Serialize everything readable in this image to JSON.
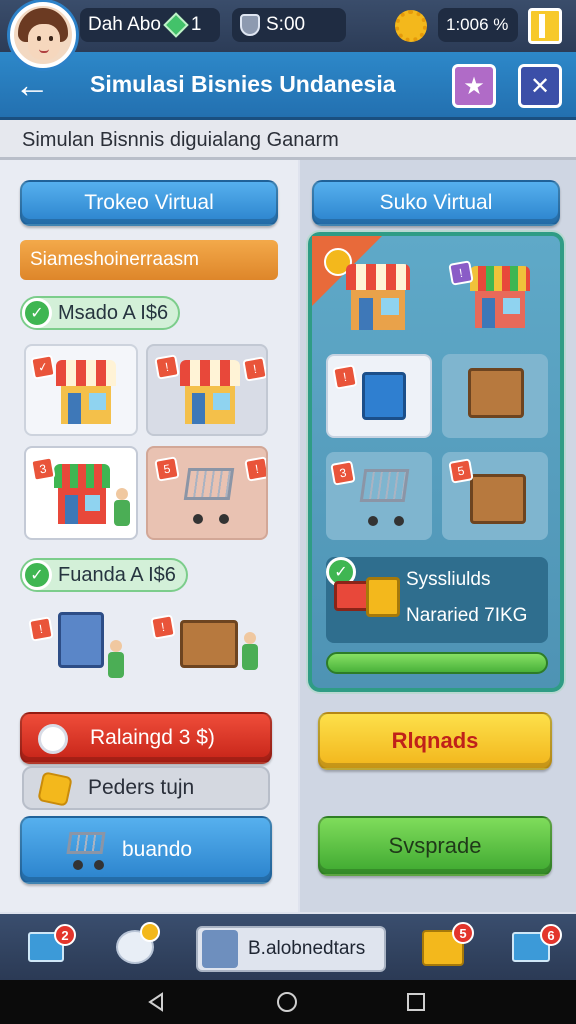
{
  "header": {
    "player_name": "Dah Abo",
    "gem_count": "1",
    "shield_value": "S:00",
    "percent_value": "1:006 %"
  },
  "titlebar": {
    "title": "Simulasi Bisnies Undanesia",
    "star_label": "★",
    "close_label": "✕"
  },
  "subtitle": "Simulan Bisnnis diguialang Ganarm",
  "left": {
    "tab_label": "Trokeo Virtual",
    "banner_label": "Siameshoinerraasm",
    "section1_label": "Msado A I$6",
    "section2_label": "Fuanda A I$6",
    "red_button_label": "Ralaingd 3 $)",
    "grey_button_label": "Peders tujn",
    "blue_button_label": "buando",
    "tile_tags": [
      "✓",
      "!",
      "!",
      "3",
      "5",
      "!",
      "!",
      "!"
    ]
  },
  "right": {
    "tab_label": "Suko Virtual",
    "stat_line1": "Syssliulds",
    "stat_line2": "Nararied 7IKG",
    "yellow_button_label": "Rlqnads",
    "green_button_label": "Svsprade",
    "tile_tags": [
      "!",
      "!",
      "3",
      "5"
    ]
  },
  "bottom": {
    "center_label": "B.alobnedtars",
    "badge_1": "2",
    "badge_center": "5",
    "badge_4": "6"
  },
  "colors": {
    "primary_blue": "#2d88c9",
    "accent_green": "#49b13a",
    "accent_red": "#e3352c",
    "accent_yellow": "#f7c92b"
  }
}
